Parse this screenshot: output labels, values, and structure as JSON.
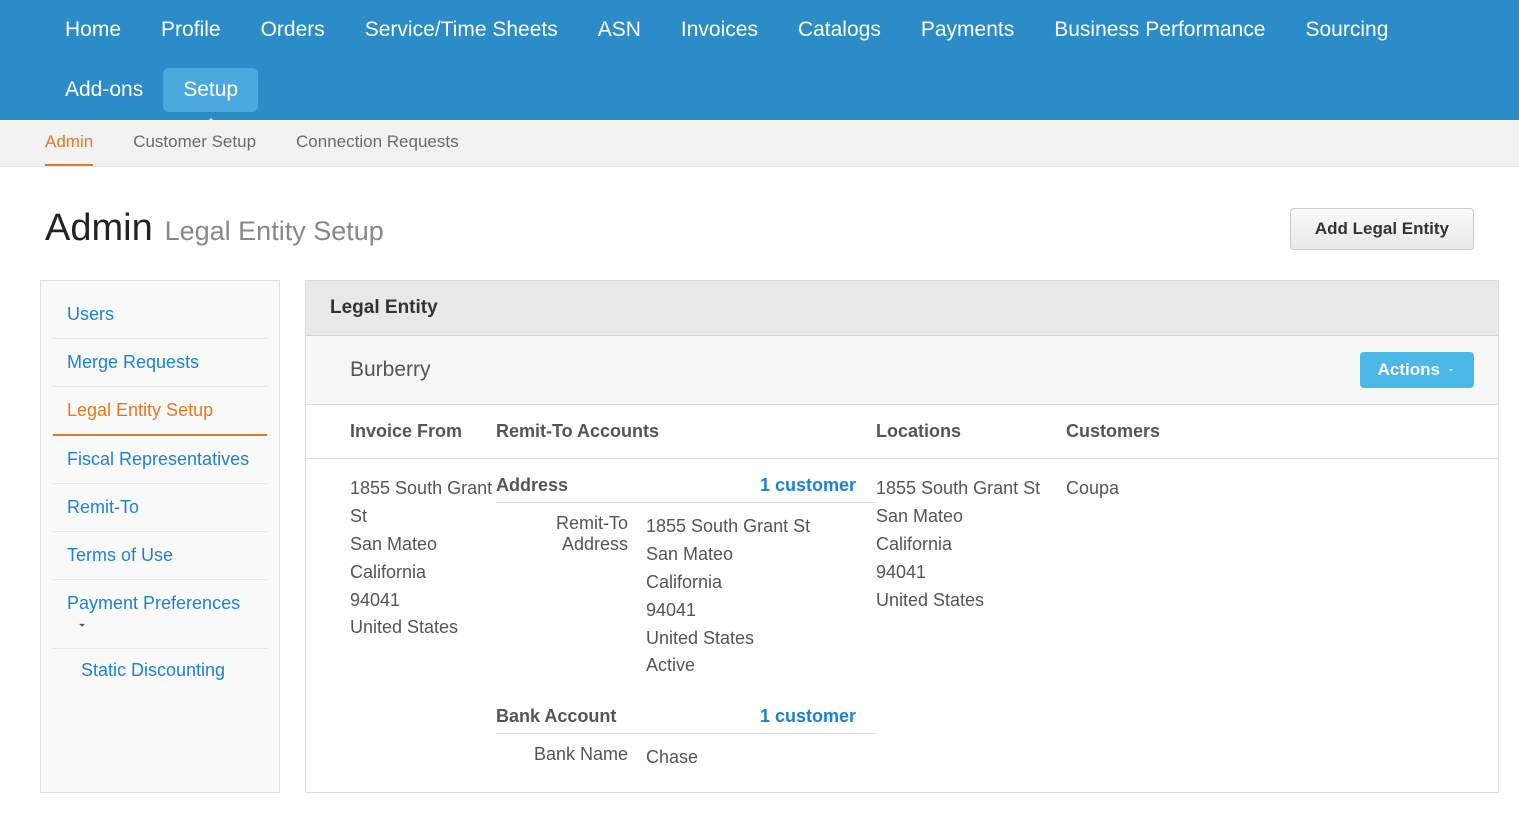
{
  "topNav": {
    "items": [
      {
        "label": "Home"
      },
      {
        "label": "Profile"
      },
      {
        "label": "Orders"
      },
      {
        "label": "Service/Time Sheets"
      },
      {
        "label": "ASN"
      },
      {
        "label": "Invoices"
      },
      {
        "label": "Catalogs"
      },
      {
        "label": "Payments"
      },
      {
        "label": "Business Performance"
      },
      {
        "label": "Sourcing"
      },
      {
        "label": "Add-ons"
      },
      {
        "label": "Setup"
      }
    ]
  },
  "subNav": {
    "items": [
      {
        "label": "Admin"
      },
      {
        "label": "Customer Setup"
      },
      {
        "label": "Connection Requests"
      }
    ]
  },
  "page": {
    "title": "Admin",
    "subtitle": "Legal Entity Setup",
    "addButton": "Add Legal Entity"
  },
  "sidebar": {
    "items": [
      {
        "label": "Users"
      },
      {
        "label": "Merge Requests"
      },
      {
        "label": "Legal Entity Setup"
      },
      {
        "label": "Fiscal Representatives"
      },
      {
        "label": "Remit-To"
      },
      {
        "label": "Terms of Use"
      },
      {
        "label": "Payment Preferences"
      }
    ],
    "subItems": [
      {
        "label": "Static Discounting"
      }
    ]
  },
  "panel": {
    "header": "Legal Entity",
    "entity": {
      "name": "Burberry",
      "actionsLabel": "Actions"
    },
    "columns": {
      "invoiceFrom": "Invoice From",
      "remitTo": "Remit-To Accounts",
      "locations": "Locations",
      "customers": "Customers"
    },
    "invoiceFrom": {
      "line1": "1855 South Grant St",
      "line2": "San Mateo",
      "line3": "California",
      "line4": "94041",
      "line5": "United States"
    },
    "remitSections": [
      {
        "title": "Address",
        "customerLink": "1 customer",
        "rows": [
          {
            "label": "Remit-To Address",
            "value": "1855 South Grant St\nSan Mateo\nCalifornia\n94041\nUnited States\nActive"
          }
        ]
      },
      {
        "title": "Bank Account",
        "customerLink": "1 customer",
        "rows": [
          {
            "label": "Bank Name",
            "value": "Chase"
          }
        ]
      }
    ],
    "locations": {
      "line1": "1855 South Grant St",
      "line2": "San Mateo",
      "line3": "California",
      "line4": "94041",
      "line5": "United States"
    },
    "customers": {
      "name": "Coupa"
    }
  }
}
